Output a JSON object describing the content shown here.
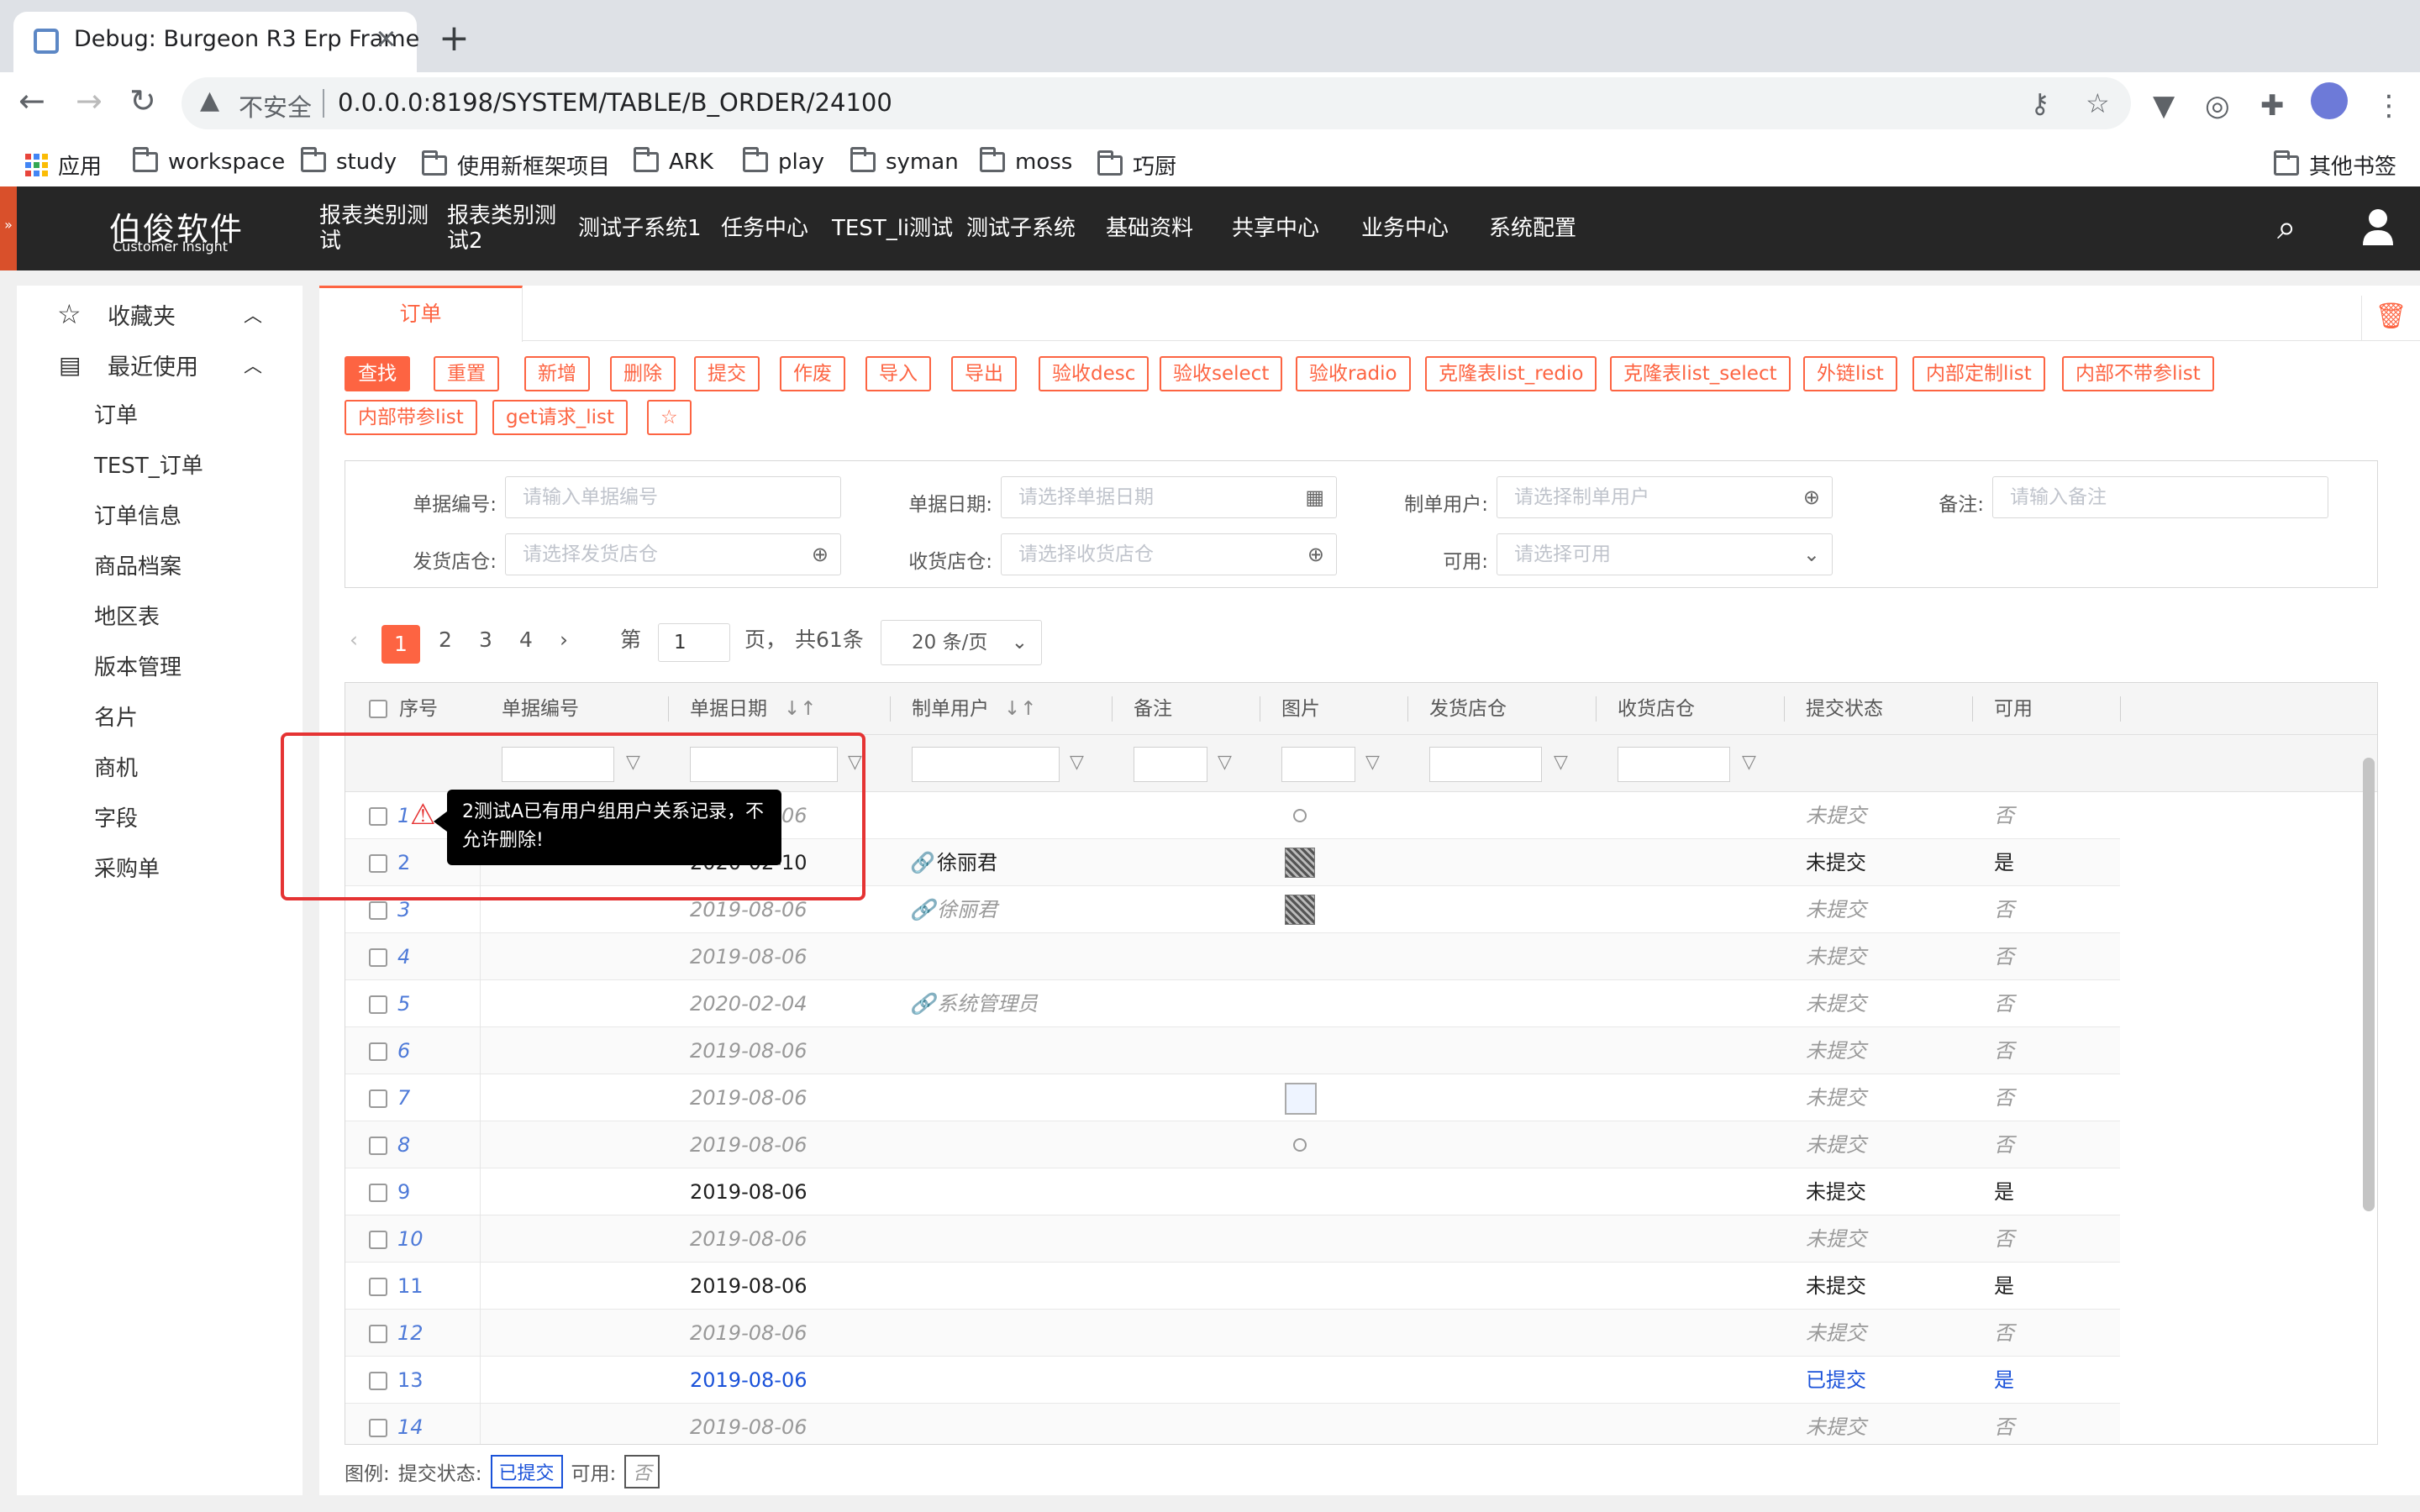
{
  "browser": {
    "tab_title": "Debug: Burgeon R3 Erp Frame",
    "insecure_label": "不安全",
    "url": "0.0.0.0:8198/SYSTEM/TABLE/B_ORDER/24100",
    "bookmarks": [
      "应用",
      "workspace",
      "study",
      "使用新框架项目",
      "ARK",
      "play",
      "syman",
      "moss",
      "巧厨"
    ],
    "other_bookmarks": "其他书签"
  },
  "app": {
    "logo_main": "伯俊软件",
    "logo_sub": "Customer Insight",
    "nav": [
      "报表类别测试",
      "报表类别测试2",
      "测试子系统1",
      "任务中心",
      "TEST_li测试",
      "测试子系统",
      "基础资料",
      "共享中心",
      "业务中心",
      "系统配置"
    ]
  },
  "sidebar": {
    "favorites": "收藏夹",
    "recent": "最近使用",
    "items": [
      "订单",
      "TEST_订单",
      "订单信息",
      "商品档案",
      "地区表",
      "版本管理",
      "名片",
      "商机",
      "字段",
      "采购单"
    ]
  },
  "main": {
    "tab": "订单",
    "buttons": [
      "查找",
      "重置",
      "新增",
      "删除",
      "提交",
      "作废",
      "导入",
      "导出",
      "验收desc",
      "验收select",
      "验收radio",
      "克隆表list_redio",
      "克隆表list_select",
      "外链list",
      "内部定制list",
      "内部不带参list"
    ],
    "buttons2": [
      "内部带参list",
      "get请求_list",
      "☆"
    ],
    "filters": {
      "order_no_label": "单据编号:",
      "order_no_ph": "请输入单据编号",
      "date_label": "单据日期:",
      "date_ph": "请选择单据日期",
      "user_label": "制单用户:",
      "user_ph": "请选择制单用户",
      "remark_label": "备注:",
      "remark_ph": "请输入备注",
      "ship_label": "发货店仓:",
      "ship_ph": "请选择发货店仓",
      "recv_label": "收货店仓:",
      "recv_ph": "请选择收货店仓",
      "avail_label": "可用:",
      "avail_ph": "请选择可用"
    },
    "pager": {
      "pages": [
        "1",
        "2",
        "3",
        "4"
      ],
      "goto_prefix": "第",
      "goto_value": "1",
      "goto_suffix": "页，",
      "total": "共61条",
      "page_size": "20 条/页"
    },
    "columns": [
      "序号",
      "单据编号",
      "单据日期",
      "制单用户",
      "备注",
      "图片",
      "发货店仓",
      "收货店仓",
      "提交状态",
      "可用"
    ],
    "rows": [
      {
        "idx": "1",
        "date": "2019-08-06",
        "user": "",
        "img": "dot",
        "status": "未提交",
        "avail": "否",
        "style": "dim"
      },
      {
        "idx": "2",
        "date": "2020-02-10",
        "user": "徐丽君",
        "img": "qr",
        "status": "未提交",
        "avail": "是",
        "style": "norm"
      },
      {
        "idx": "3",
        "date": "2019-08-06",
        "user": "徐丽君",
        "img": "qr",
        "status": "未提交",
        "avail": "否",
        "style": "dim"
      },
      {
        "idx": "4",
        "date": "2019-08-06",
        "user": "",
        "img": "",
        "status": "未提交",
        "avail": "否",
        "style": "dim"
      },
      {
        "idx": "5",
        "date": "2020-02-04",
        "user": "系统管理员",
        "img": "",
        "status": "未提交",
        "avail": "否",
        "style": "dim"
      },
      {
        "idx": "6",
        "date": "2019-08-06",
        "user": "",
        "img": "",
        "status": "未提交",
        "avail": "否",
        "style": "dim"
      },
      {
        "idx": "7",
        "date": "2019-08-06",
        "user": "",
        "img": "broken",
        "status": "未提交",
        "avail": "否",
        "style": "dim"
      },
      {
        "idx": "8",
        "date": "2019-08-06",
        "user": "",
        "img": "dot",
        "status": "未提交",
        "avail": "否",
        "style": "dim"
      },
      {
        "idx": "9",
        "date": "2019-08-06",
        "user": "",
        "img": "",
        "status": "未提交",
        "avail": "是",
        "style": "norm"
      },
      {
        "idx": "10",
        "date": "2019-08-06",
        "user": "",
        "img": "",
        "status": "未提交",
        "avail": "否",
        "style": "dim"
      },
      {
        "idx": "11",
        "date": "2019-08-06",
        "user": "",
        "img": "",
        "status": "未提交",
        "avail": "是",
        "style": "norm"
      },
      {
        "idx": "12",
        "date": "2019-08-06",
        "user": "",
        "img": "",
        "status": "未提交",
        "avail": "否",
        "style": "dim"
      },
      {
        "idx": "13",
        "date": "2019-08-06",
        "user": "",
        "img": "",
        "status": "已提交",
        "avail": "是",
        "style": "sub"
      },
      {
        "idx": "14",
        "date": "2019-08-06",
        "user": "",
        "img": "",
        "status": "未提交",
        "avail": "否",
        "style": "dim"
      }
    ],
    "legend": {
      "label": "图例:",
      "status_label": "提交状态:",
      "status_value": "已提交",
      "avail_label": "可用:",
      "avail_value": "否"
    },
    "tooltip": "2测试A已有用户组用户关系记录，不允许删除!"
  },
  "colors": {
    "accent": "#fd6442",
    "header_bg": "#262626",
    "submitted": "#1a52d9",
    "highlight": "#e53333"
  }
}
